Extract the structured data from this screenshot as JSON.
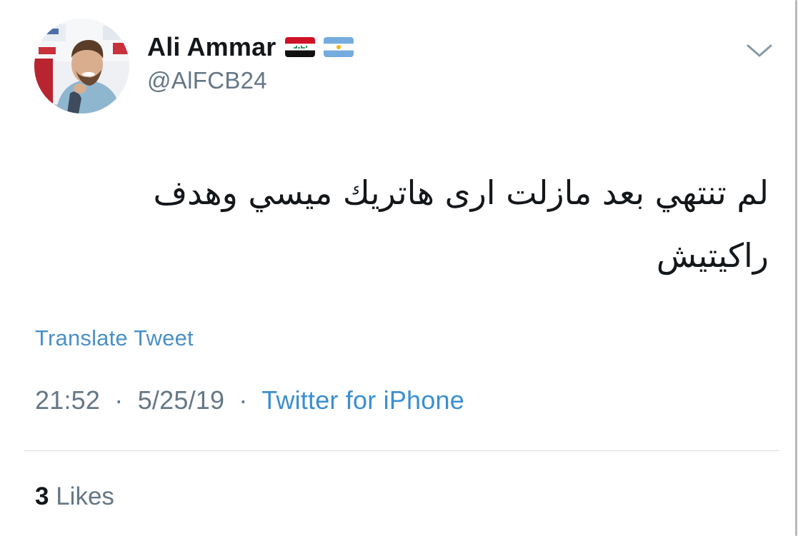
{
  "tweet": {
    "author": {
      "display_name": "Ali Ammar",
      "handle": "@AlFCB24",
      "flags": [
        "iraq-flag-icon",
        "argentina-flag-icon"
      ]
    },
    "text_line_1": "لم تنتهي بعد مازلت ارى هاتريك ميسي وهدف",
    "text_line_2": "راكيتيش",
    "translate_label": "Translate Tweet",
    "time": "21:52",
    "date": "5/25/19",
    "meta_separator": "·",
    "source": "Twitter for iPhone",
    "likes_count": "3",
    "likes_label": "Likes"
  },
  "colors": {
    "text_primary": "#14171a",
    "text_secondary": "#657786",
    "link_blue": "#3b8fd1",
    "divider": "#d6dbdf"
  },
  "icons": {
    "menu": "chevron-down-icon"
  }
}
